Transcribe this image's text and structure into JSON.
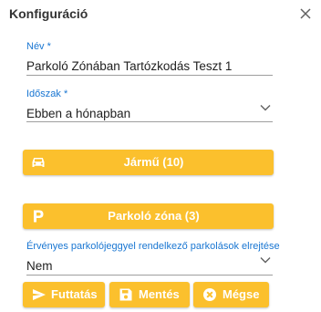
{
  "dialog": {
    "title": "Konfiguráció"
  },
  "form": {
    "name": {
      "label": "Név *",
      "value": "Parkoló Zónában Tartózkodás Teszt 1"
    },
    "period": {
      "label": "Időszak *",
      "value": "Ebben a hónapban"
    },
    "vehicle_button": {
      "label": "Jármű (10)",
      "icon": "car-icon"
    },
    "zone_button": {
      "label": "Parkoló zóna (3)",
      "icon": "parking-icon"
    },
    "exclude": {
      "label": "Érvényes parkolójeggyel rendelkező parkolások elrejtése",
      "value": "Nem"
    }
  },
  "actions": {
    "run": {
      "label": "Futtatás",
      "icon": "send-icon"
    },
    "save": {
      "label": "Mentés",
      "icon": "save-icon"
    },
    "cancel": {
      "label": "Mégse",
      "icon": "cancel-icon"
    }
  },
  "colors": {
    "accent": "#fbc02d",
    "label": "#1976d2"
  }
}
